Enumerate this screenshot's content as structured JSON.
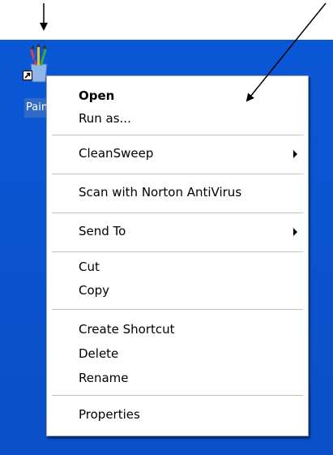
{
  "desktop": {
    "shortcut": {
      "label": "Paint",
      "icon": "paint-brushes-icon",
      "overlay_icon": "shortcut-arrow-icon"
    }
  },
  "context_menu": {
    "items": [
      {
        "label": "Open",
        "bold": true
      },
      {
        "label": "Run as..."
      },
      {
        "label": "CleanSweep",
        "submenu": true
      },
      {
        "label": "Scan with Norton AntiVirus"
      },
      {
        "label": "Send To",
        "submenu": true
      },
      {
        "label": "Cut"
      },
      {
        "label": "Copy"
      },
      {
        "label": "Create Shortcut"
      },
      {
        "label": "Delete"
      },
      {
        "label": "Rename"
      },
      {
        "label": "Properties"
      }
    ]
  },
  "colors": {
    "desktop_background": "#0a55d4",
    "selection_highlight": "#316ac5",
    "menu_background": "#ffffff",
    "separator": "#c5c2b2"
  }
}
